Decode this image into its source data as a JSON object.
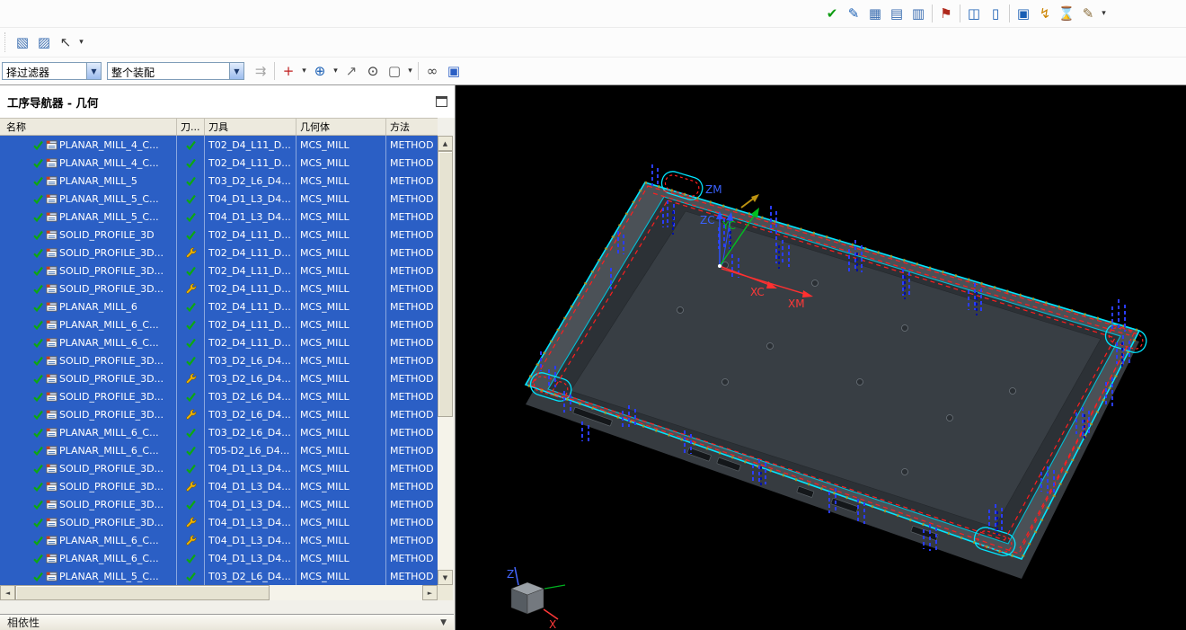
{
  "icons": {
    "dropdown": "▼",
    "up": "▲",
    "down": "▼",
    "left": "◄",
    "right": "►",
    "chevron": "▼"
  },
  "filters": {
    "selection_filter": "择过滤器",
    "assembly_scope": "整个装配"
  },
  "toolbar_main": {
    "icons": [
      {
        "name": "verify-toolpath-icon",
        "glyph": "✔",
        "color": "#0e9c12"
      },
      {
        "name": "simulate-toolpath-icon",
        "glyph": "✎",
        "color": "#1a5fb4"
      },
      {
        "name": "program-order-view-icon",
        "glyph": "▦",
        "color": "#3a6db0"
      },
      {
        "name": "machine-tool-view-icon",
        "glyph": "▤",
        "color": "#3a6db0"
      },
      {
        "name": "geometry-view-icon",
        "glyph": "▥",
        "color": "#3a6db0"
      },
      {
        "name": "separator",
        "sep": true
      },
      {
        "name": "flag-icon",
        "glyph": "⚑",
        "color": "#b0291c"
      },
      {
        "name": "separator",
        "sep": true
      },
      {
        "name": "toolpath-visualize-icon",
        "glyph": "◫",
        "color": "#1a5fb4"
      },
      {
        "name": "listing-window-icon",
        "glyph": "▯",
        "color": "#1a5fb4"
      },
      {
        "name": "separator",
        "sep": true
      },
      {
        "name": "copy-listing-icon",
        "glyph": "▣",
        "color": "#1a5fb4"
      },
      {
        "name": "postprocess-icon",
        "glyph": "↯",
        "color": "#cc8400"
      },
      {
        "name": "machining-time-icon",
        "glyph": "⌛",
        "color": "#1a5fb4"
      },
      {
        "name": "shop-documentation-icon",
        "glyph": "✎",
        "color": "#8a6d3b"
      },
      {
        "name": "dropdown-arrow-icon",
        "glyph": "▾",
        "arrow": true,
        "color": "#333333"
      }
    ]
  },
  "toolbar_nav": {
    "icons": [
      {
        "name": "navigator-view-icon",
        "glyph": "▧",
        "color": "#3a6db0"
      },
      {
        "name": "export-table-icon",
        "glyph": "▨",
        "color": "#3a6db0"
      },
      {
        "name": "selection-cursor-icon",
        "glyph": "↖",
        "color": "#3c3c3c"
      },
      {
        "name": "dropdown-arrow-icon",
        "glyph": "▾",
        "arrow": true,
        "color": "#333333"
      }
    ]
  },
  "toolbar_select": {
    "icons": [
      {
        "name": "filter-link-icon-disabled",
        "glyph": "⇉",
        "color": "#a8a8a8"
      },
      {
        "name": "separator",
        "sep": true
      },
      {
        "name": "snap-point-icon",
        "glyph": "+",
        "color": "#c02020"
      },
      {
        "name": "dropdown-arrow-icon",
        "glyph": "▾",
        "arrow": true,
        "color": "#333333"
      },
      {
        "name": "point-dialog-icon",
        "glyph": "⊕",
        "color": "#1a5fb4"
      },
      {
        "name": "dropdown-arrow-icon",
        "glyph": "▾",
        "arrow": true,
        "color": "#333333"
      },
      {
        "name": "measure-distance-icon",
        "glyph": "↗",
        "color": "#666666"
      },
      {
        "name": "datum-point-icon",
        "glyph": "⊙",
        "color": "#333333"
      },
      {
        "name": "rectangle-select-icon",
        "glyph": "▢",
        "color": "#555555"
      },
      {
        "name": "dropdown-arrow-icon",
        "glyph": "▾",
        "arrow": true,
        "color": "#333333"
      },
      {
        "name": "separator",
        "sep": true
      },
      {
        "name": "view-glasses-icon",
        "glyph": "∞",
        "color": "#444444"
      },
      {
        "name": "shaded-display-icon",
        "glyph": "▣",
        "color": "#2b5fc5"
      }
    ]
  },
  "navigator": {
    "title": "工序导航器 - 几何",
    "dependencies_title": "相依性",
    "columns": [
      "名称",
      "刀...",
      "刀具",
      "几何体",
      "方法"
    ],
    "rows": [
      {
        "name": "PLANAR_MILL_4_C...",
        "needs_regen": false,
        "tool": "T02_D4_L11_D...",
        "geometry": "MCS_MILL",
        "method": "METHOD"
      },
      {
        "name": "PLANAR_MILL_4_C...",
        "needs_regen": false,
        "tool": "T02_D4_L11_D...",
        "geometry": "MCS_MILL",
        "method": "METHOD"
      },
      {
        "name": "PLANAR_MILL_5",
        "needs_regen": false,
        "tool": "T03_D2_L6_D4...",
        "geometry": "MCS_MILL",
        "method": "METHOD"
      },
      {
        "name": "PLANAR_MILL_5_C...",
        "needs_regen": false,
        "tool": "T04_D1_L3_D4...",
        "geometry": "MCS_MILL",
        "method": "METHOD"
      },
      {
        "name": "PLANAR_MILL_5_C...",
        "needs_regen": false,
        "tool": "T04_D1_L3_D4...",
        "geometry": "MCS_MILL",
        "method": "METHOD"
      },
      {
        "name": "SOLID_PROFILE_3D",
        "needs_regen": false,
        "tool": "T02_D4_L11_D...",
        "geometry": "MCS_MILL",
        "method": "METHOD"
      },
      {
        "name": "SOLID_PROFILE_3D...",
        "needs_regen": true,
        "tool": "T02_D4_L11_D...",
        "geometry": "MCS_MILL",
        "method": "METHOD"
      },
      {
        "name": "SOLID_PROFILE_3D...",
        "needs_regen": false,
        "tool": "T02_D4_L11_D...",
        "geometry": "MCS_MILL",
        "method": "METHOD"
      },
      {
        "name": "SOLID_PROFILE_3D...",
        "needs_regen": true,
        "tool": "T02_D4_L11_D...",
        "geometry": "MCS_MILL",
        "method": "METHOD"
      },
      {
        "name": "PLANAR_MILL_6",
        "needs_regen": false,
        "tool": "T02_D4_L11_D...",
        "geometry": "MCS_MILL",
        "method": "METHOD"
      },
      {
        "name": "PLANAR_MILL_6_C...",
        "needs_regen": false,
        "tool": "T02_D4_L11_D...",
        "geometry": "MCS_MILL",
        "method": "METHOD"
      },
      {
        "name": "PLANAR_MILL_6_C...",
        "needs_regen": false,
        "tool": "T02_D4_L11_D...",
        "geometry": "MCS_MILL",
        "method": "METHOD"
      },
      {
        "name": "SOLID_PROFILE_3D...",
        "needs_regen": false,
        "tool": "T03_D2_L6_D4...",
        "geometry": "MCS_MILL",
        "method": "METHOD"
      },
      {
        "name": "SOLID_PROFILE_3D...",
        "needs_regen": true,
        "tool": "T03_D2_L6_D4...",
        "geometry": "MCS_MILL",
        "method": "METHOD"
      },
      {
        "name": "SOLID_PROFILE_3D...",
        "needs_regen": false,
        "tool": "T03_D2_L6_D4...",
        "geometry": "MCS_MILL",
        "method": "METHOD"
      },
      {
        "name": "SOLID_PROFILE_3D...",
        "needs_regen": true,
        "tool": "T03_D2_L6_D4...",
        "geometry": "MCS_MILL",
        "method": "METHOD"
      },
      {
        "name": "PLANAR_MILL_6_C...",
        "needs_regen": false,
        "tool": "T03_D2_L6_D4...",
        "geometry": "MCS_MILL",
        "method": "METHOD"
      },
      {
        "name": "PLANAR_MILL_6_C...",
        "needs_regen": false,
        "tool": "T05-D2_L6_D4...",
        "geometry": "MCS_MILL",
        "method": "METHOD"
      },
      {
        "name": "SOLID_PROFILE_3D...",
        "needs_regen": false,
        "tool": "T04_D1_L3_D4...",
        "geometry": "MCS_MILL",
        "method": "METHOD"
      },
      {
        "name": "SOLID_PROFILE_3D...",
        "needs_regen": true,
        "tool": "T04_D1_L3_D4...",
        "geometry": "MCS_MILL",
        "method": "METHOD"
      },
      {
        "name": "SOLID_PROFILE_3D...",
        "needs_regen": false,
        "tool": "T04_D1_L3_D4...",
        "geometry": "MCS_MILL",
        "method": "METHOD"
      },
      {
        "name": "SOLID_PROFILE_3D...",
        "needs_regen": true,
        "tool": "T04_D1_L3_D4...",
        "geometry": "MCS_MILL",
        "method": "METHOD"
      },
      {
        "name": "PLANAR_MILL_6_C...",
        "needs_regen": true,
        "tool": "T04_D1_L3_D4...",
        "geometry": "MCS_MILL",
        "method": "METHOD"
      },
      {
        "name": "PLANAR_MILL_6_C...",
        "needs_regen": false,
        "tool": "T04_D1_L3_D4...",
        "geometry": "MCS_MILL",
        "method": "METHOD"
      },
      {
        "name": "PLANAR_MILL_5_C...",
        "needs_regen": false,
        "tool": "T03_D2_L6_D4...",
        "geometry": "MCS_MILL",
        "method": "METHOD"
      }
    ]
  },
  "viewport": {
    "axes": {
      "zm": "ZM",
      "zc": "ZC",
      "yc": "YC",
      "xc": "XC",
      "xm": "XM"
    },
    "triad": {
      "z": "Z",
      "x": "X"
    }
  },
  "colors": {
    "selection_blue": "#2b5fc5",
    "check_green": "#0da810",
    "wrench_yellow": "#f0b400",
    "highlight_cyan": "#00e6ff",
    "toolpath_red": "#ff1e1e",
    "toolpath_blue": "#2a3cff",
    "viewport_bg": "#000000"
  }
}
